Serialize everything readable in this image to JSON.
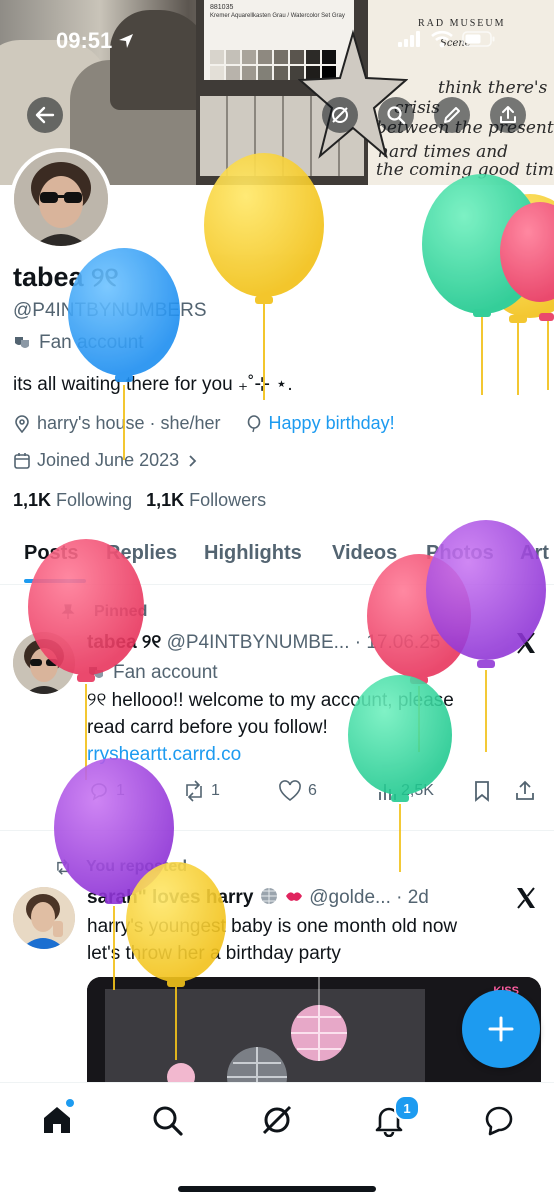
{
  "status_bar": {
    "time": "09:51"
  },
  "banner": {
    "card_label_1": "881035",
    "card_label_2": "Kremer Aquarellkasten Grau / Watercolor Set Gray",
    "museum": "RAD MUSEUM",
    "museum_sub": "Scene",
    "note_lines": [
      "think there's",
      "crisis",
      "between the present",
      "hard times and",
      "the coming good times"
    ]
  },
  "profile": {
    "name": "tabea ୨୧",
    "handle": "@P4INTBYNUMBERS",
    "category": "Fan account",
    "bio": "its all waiting there for you ₊˚⊹ ⋆.",
    "location": "harry's house · she/her",
    "birthday": "Happy birthday!",
    "joined": "Joined June 2023",
    "following_count": "1,1K",
    "following_label": "Following",
    "followers_count": "1,1K",
    "followers_label": "Followers"
  },
  "tabs": [
    "Posts",
    "Replies",
    "Highlights",
    "Videos",
    "Photos",
    "Art"
  ],
  "pinned_post": {
    "pinned_label": "Pinned",
    "author": "tabea ୨୧",
    "handle_date": "@P4INTBYNUMBE... · 17.06.25",
    "badge": "Fan account",
    "text_line1": "୨୧ hellooo!! welcome to my account, please",
    "text_line2": "read carrd before you follow!",
    "link": "rrysheartt.carrd.co",
    "replies": "1",
    "reposts": "1",
    "likes": "6",
    "views": "2,5K"
  },
  "repost": {
    "reposted_label": "You reposted",
    "author": "sarah\" loves harry",
    "handle_date": "@golde... · 2d",
    "text_line1": "harry's youngest baby is one month old now",
    "text_line2": "let's throw her a birthday party",
    "media_label": "KISS"
  },
  "nav": {
    "items": [
      "home-icon",
      "search-icon",
      "grok-icon",
      "notifications-icon",
      "messages-icon"
    ],
    "notification_badge": "1"
  },
  "colors": {
    "accent": "#1d9bf0",
    "text": "#0f1419",
    "muted": "#536471"
  }
}
